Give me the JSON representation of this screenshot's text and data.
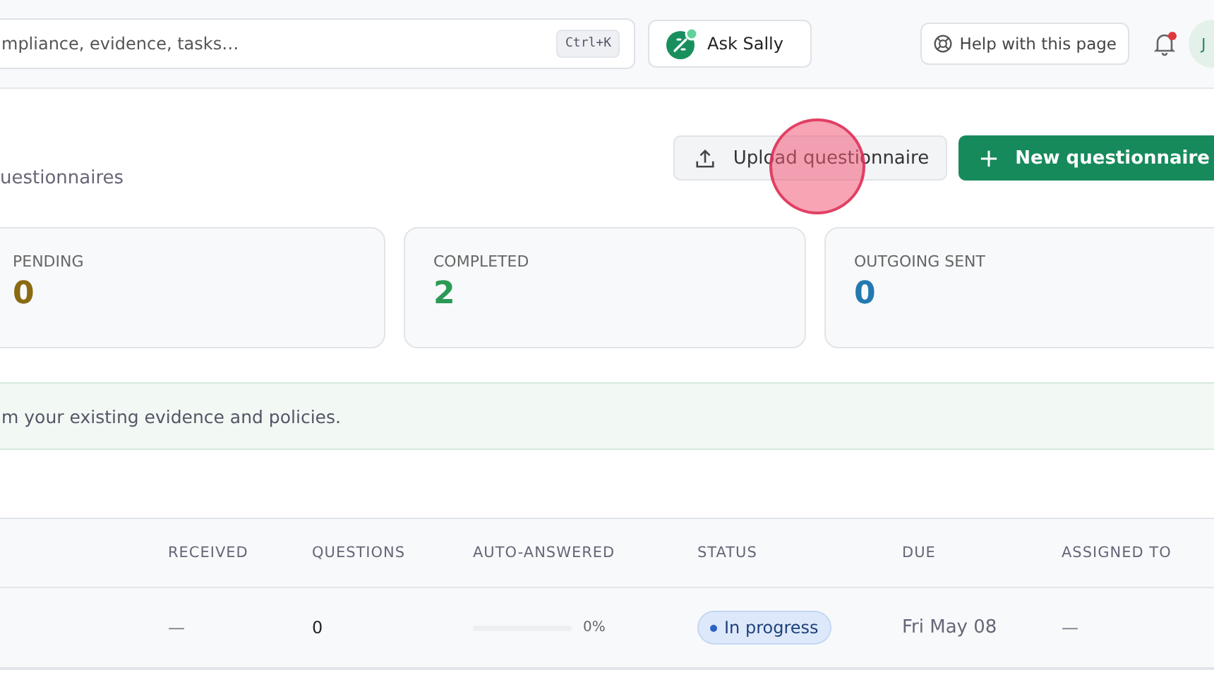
{
  "header": {
    "search": {
      "placeholder": "mpliance, evidence, tasks…",
      "shortcut": "Ctrl+K"
    },
    "ask_button": "Ask Sally",
    "help_button": "Help with this page",
    "notifications": {
      "unread": true
    },
    "avatar": "J"
  },
  "page": {
    "subtitle": "uestionnaires",
    "buttons": [
      {
        "kind": "secondary",
        "label": "Upload questionnaire"
      },
      {
        "kind": "primary",
        "label": "New questionnaire"
      }
    ]
  },
  "stats": [
    {
      "label": "PENDING",
      "value": "0",
      "color": "#8a6a12"
    },
    {
      "label": "COMPLETED",
      "value": "2",
      "color": "#2a9a55"
    },
    {
      "label": "OUTGOING SENT",
      "value": "0",
      "color": "#2479b0"
    }
  ],
  "banner": "m your existing evidence and policies.",
  "table": {
    "columns": [
      "RECEIVED",
      "QUESTIONS",
      "AUTO-ANSWERED",
      "STATUS",
      "DUE",
      "ASSIGNED TO"
    ],
    "rows": [
      {
        "received": "—",
        "questions": "0",
        "auto_answered": {
          "level": 0,
          "reading": "0%"
        },
        "status": "In progress",
        "due": "Fri May 08",
        "assigned_to": "—"
      }
    ]
  },
  "click_marker": true
}
